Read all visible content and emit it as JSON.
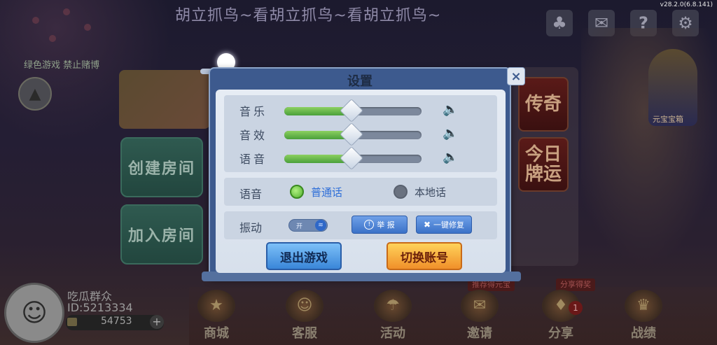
{
  "status": {
    "version": "v28.2.0(6.8.141)"
  },
  "marquee": {
    "text": "胡立抓鸟~看胡立抓鸟~看胡立抓鸟~"
  },
  "top_icons": [
    {
      "name": "friends-icon",
      "glyph": "♣"
    },
    {
      "name": "mail-icon",
      "glyph": "✉"
    },
    {
      "name": "help-icon",
      "glyph": "?"
    },
    {
      "name": "settings-gear-icon",
      "glyph": "⚙"
    }
  ],
  "lobby": {
    "notice": "绿色游戏 禁止赌博",
    "create_room": "创建房间",
    "join_room": "加入房间",
    "card_legend": "传奇",
    "card_fortune": "今日牌运",
    "god_label": "元宝宝箱",
    "tag_recommend": "推荐得元宝",
    "tag_share": "分享得奖"
  },
  "player": {
    "name": "吃瓜群众",
    "id": "ID:5213334",
    "coins": "54753",
    "plus": "+"
  },
  "dock": [
    {
      "name": "dock-shop",
      "label": "商城",
      "glyph": "★"
    },
    {
      "name": "dock-service",
      "label": "客服",
      "glyph": "☺"
    },
    {
      "name": "dock-activity",
      "label": "活动",
      "glyph": "☂"
    },
    {
      "name": "dock-invite",
      "label": "邀请",
      "glyph": "✉"
    },
    {
      "name": "dock-share",
      "label": "分享",
      "glyph": "♦"
    },
    {
      "name": "dock-record",
      "label": "战绩",
      "glyph": "♛"
    }
  ],
  "share_count": "1",
  "settings": {
    "title": "设置",
    "close": "×",
    "sliders": [
      {
        "label": "音乐",
        "value": 0.49
      },
      {
        "label": "音效",
        "value": 0.49
      },
      {
        "label": "语音",
        "value": 0.49
      }
    ],
    "voice": {
      "label": "语音",
      "options": [
        {
          "label": "普通话",
          "selected": true
        },
        {
          "label": "本地话",
          "selected": false
        }
      ]
    },
    "vibration": {
      "label": "振动",
      "state_text": "开",
      "enabled": true
    },
    "report_button": "举 报",
    "repair_button": "一键修复",
    "exit_button": "退出游戏",
    "switch_button": "切换账号"
  },
  "colors": {
    "dialog_frame": "#3d5a8e",
    "selected_option": "#2f6fd8",
    "unselected_option": "#3c4a60"
  }
}
